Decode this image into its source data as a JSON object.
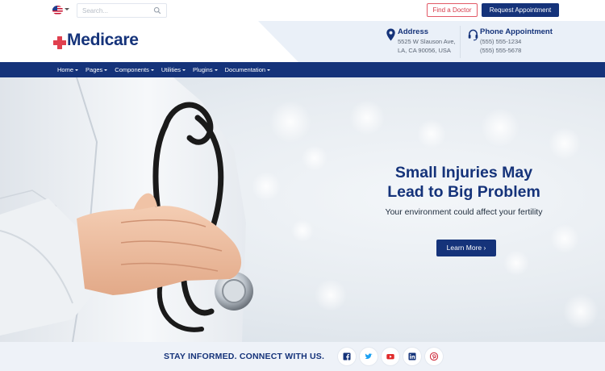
{
  "topbar": {
    "language_flag": "us-flag-icon",
    "search_placeholder": "Search...",
    "find_doctor_label": "Find a Doctor",
    "request_appointment_label": "Request Appointment"
  },
  "header": {
    "logo_text": "Medicare",
    "address": {
      "title": "Address",
      "line1": "5525 W Slauson Ave,",
      "line2": "LA, CA 90056, USA"
    },
    "phone": {
      "title": "Phone Appointment",
      "line1": "(555) 555-1234",
      "line2": "(555) 555-5678"
    }
  },
  "nav": {
    "items": [
      {
        "label": "Home"
      },
      {
        "label": "Pages"
      },
      {
        "label": "Components"
      },
      {
        "label": "Utilities"
      },
      {
        "label": "Plugins"
      },
      {
        "label": "Documentation"
      }
    ]
  },
  "hero": {
    "heading_line1": "Small Injuries May",
    "heading_line2": "Lead to Big Problem",
    "subheading": "Your environment could affect your fertility",
    "cta_label": "Learn More ›"
  },
  "connect": {
    "title": "STAY INFORMED. CONNECT WITH US.",
    "socials": [
      "facebook-icon",
      "twitter-icon",
      "youtube-icon",
      "linkedin-icon",
      "pinterest-icon"
    ]
  },
  "colors": {
    "brand_navy": "#15337a",
    "accent_red": "#d63a4a",
    "youtube_red": "#e02a2a",
    "pinterest_red": "#cc2233",
    "header_bg": "#eaf0f8"
  }
}
